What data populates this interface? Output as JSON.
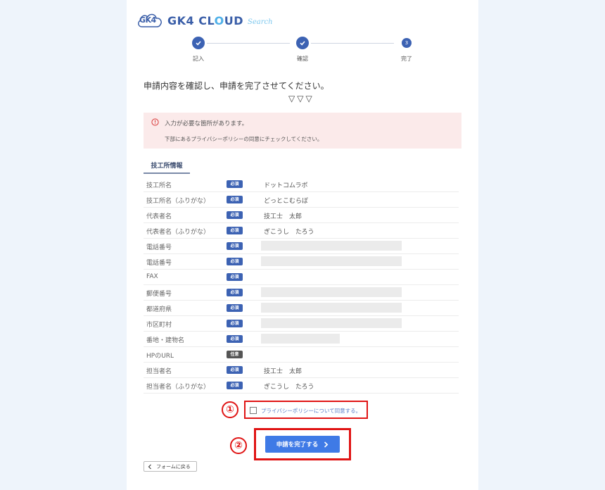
{
  "brand": {
    "badge_text": "GK4",
    "name_part1": "GK4 CL",
    "name_o": "O",
    "name_part2": "UD",
    "sub": "Search"
  },
  "steps": [
    {
      "label": "記入",
      "state": "done"
    },
    {
      "label": "確認",
      "state": "done"
    },
    {
      "label": "完了",
      "state": "current",
      "number": "3"
    }
  ],
  "instruction": "申請内容を確認し、申請を完了させてください。",
  "arrows": "▽▽▽",
  "alert": {
    "title": "入力が必要な箇所があります。",
    "detail": "下部にあるプライバシーポリシーの同意にチェックしてください。"
  },
  "section_title": "技工所情報",
  "badges": {
    "required": "必須",
    "optional": "任意"
  },
  "rows": [
    {
      "label": "技工所名",
      "badge": "必須",
      "value": "ドットコムラボ"
    },
    {
      "label": "技工所名（ふりがな）",
      "badge": "必須",
      "value": "どっとこむらぼ"
    },
    {
      "label": "代表者名",
      "badge": "必須",
      "value": "技工士　太郎"
    },
    {
      "label": "代表者名（ふりがな）",
      "badge": "必須",
      "value": "ぎこうし　たろう"
    },
    {
      "label": "電話番号",
      "badge": "必須",
      "value": ""
    },
    {
      "label": "電話番号",
      "badge": "必須",
      "value": ""
    },
    {
      "label": "FAX",
      "badge": "必須",
      "value": ""
    },
    {
      "label": "郵便番号",
      "badge": "必須",
      "value": ""
    },
    {
      "label": "都道府県",
      "badge": "必須",
      "value": ""
    },
    {
      "label": "市区町村",
      "badge": "必須",
      "value": ""
    },
    {
      "label": "番地・建物名",
      "badge": "必須",
      "value": ""
    },
    {
      "label": "HPのURL",
      "badge": "任意",
      "value": ""
    },
    {
      "label": "担当者名",
      "badge": "必須",
      "value": "技工士　太郎"
    },
    {
      "label": "担当者名（ふりがな）",
      "badge": "必須",
      "value": "ぎこうし　たろう"
    }
  ],
  "consent": {
    "label": "プライバシーポリシーについて同意する。",
    "checked": false
  },
  "annotations": {
    "one": "①",
    "two": "②"
  },
  "submit_label": "申請を完了する",
  "back_label": "フォームに戻る",
  "colors": {
    "accent": "#3c62b3",
    "button": "#3f7ae6",
    "annotation": "#e01414",
    "alert_bg": "#fbeaea"
  }
}
